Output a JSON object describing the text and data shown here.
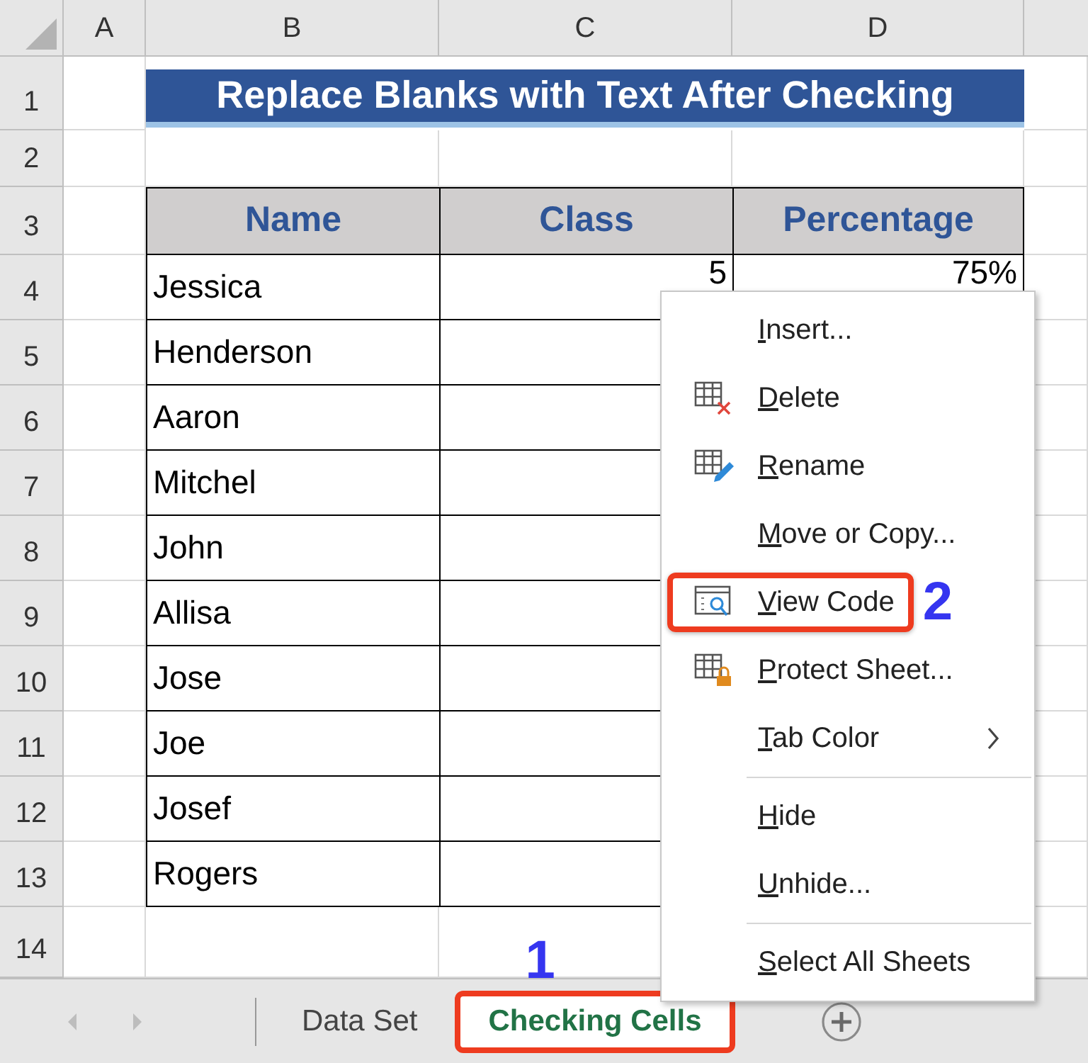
{
  "sheet": {
    "columns": [
      "A",
      "B",
      "C",
      "D"
    ],
    "rows": [
      "1",
      "2",
      "3",
      "4",
      "5",
      "6",
      "7",
      "8",
      "9",
      "10",
      "11",
      "12",
      "13",
      "14"
    ],
    "title": "Replace Blanks with Text After Checking",
    "table": {
      "columns": [
        "Name",
        "Class",
        "Percentage"
      ],
      "rows": [
        {
          "name": "Jessica",
          "class": "5",
          "percentage": "75%"
        },
        {
          "name": "Henderson"
        },
        {
          "name": "Aaron"
        },
        {
          "name": "Mitchel"
        },
        {
          "name": "John"
        },
        {
          "name": "Allisa"
        },
        {
          "name": "Jose"
        },
        {
          "name": "Joe"
        },
        {
          "name": "Josef"
        },
        {
          "name": "Rogers"
        }
      ]
    }
  },
  "context_menu": {
    "items": [
      {
        "kind": "plain",
        "label": "Insert...",
        "highlighted": false
      },
      {
        "kind": "delete",
        "label": "Delete",
        "highlighted": false
      },
      {
        "kind": "rename",
        "label": "Rename",
        "highlighted": false
      },
      {
        "kind": "plain",
        "label": "Move or Copy...",
        "highlighted": false
      },
      {
        "kind": "view_code",
        "label": "View Code",
        "highlighted": true,
        "annotation": "2"
      },
      {
        "kind": "protect",
        "label": "Protect Sheet...",
        "highlighted": false
      },
      {
        "kind": "submenu",
        "label": "Tab Color",
        "highlighted": false
      },
      {
        "kind": "separator"
      },
      {
        "kind": "plain",
        "label": "Hide",
        "highlighted": false
      },
      {
        "kind": "plain",
        "label": "Unhide...",
        "highlighted": false
      },
      {
        "kind": "separator"
      },
      {
        "kind": "plain",
        "label": "Select All Sheets",
        "highlighted": false
      }
    ]
  },
  "sheet_tabs": [
    {
      "label": "Data Set",
      "selected": false,
      "highlighted": false
    },
    {
      "label": "Checking Cells",
      "selected": true,
      "highlighted": true,
      "annotation": "1"
    }
  ]
}
